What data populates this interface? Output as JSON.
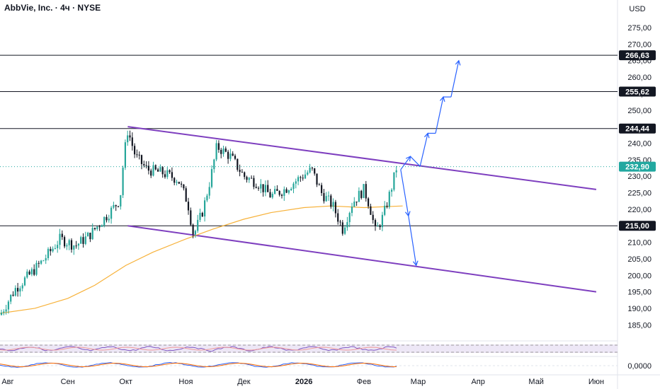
{
  "header": {
    "title": "AbbVie, Inc. · 4ч · NYSE"
  },
  "colors": {
    "up": "#26a69a",
    "down": "#131722",
    "ma": "#f7b23b",
    "channel": "#7e3fbf",
    "projection": "#2962ff",
    "price_tag": "#22a8a0",
    "level": "#131722"
  },
  "chart_data": {
    "type": "candlestick",
    "currency_label": "USD",
    "ylim": [
      181,
      278
    ],
    "y_ticks": [
      "275,00",
      "270,00",
      "265,00",
      "260,00",
      "255,00",
      "250,00",
      "245,00",
      "240,00",
      "235,00",
      "230,00",
      "225,00",
      "220,00",
      "215,00",
      "210,00",
      "205,00",
      "200,00",
      "195,00",
      "190,00",
      "185,00"
    ],
    "y_tick_values": [
      275,
      270,
      265,
      260,
      255,
      250,
      245,
      240,
      235,
      230,
      225,
      220,
      215,
      210,
      205,
      200,
      195,
      190,
      185
    ],
    "x_range": [
      "2025-07-28",
      "2026-06-12"
    ],
    "x_ticks": [
      {
        "label": "Авг",
        "date": "2025-08-01"
      },
      {
        "label": "Сен",
        "date": "2025-09-01"
      },
      {
        "label": "Окт",
        "date": "2025-10-01"
      },
      {
        "label": "Ноя",
        "date": "2025-11-01"
      },
      {
        "label": "Дек",
        "date": "2025-12-01"
      },
      {
        "label": "2026",
        "date": "2026-01-01",
        "bold": true
      },
      {
        "label": "Фев",
        "date": "2026-02-01"
      },
      {
        "label": "Мар",
        "date": "2026-03-01"
      },
      {
        "label": "Апр",
        "date": "2026-04-01"
      },
      {
        "label": "Май",
        "date": "2026-05-01"
      },
      {
        "label": "Июн",
        "date": "2026-06-01"
      }
    ],
    "price_path": [
      [
        "2025-07-28",
        188
      ],
      [
        "2025-08-05",
        196
      ],
      [
        "2025-08-12",
        200
      ],
      [
        "2025-08-20",
        205
      ],
      [
        "2025-08-28",
        211
      ],
      [
        "2025-09-05",
        209
      ],
      [
        "2025-09-12",
        212
      ],
      [
        "2025-09-18",
        216
      ],
      [
        "2025-09-24",
        220
      ],
      [
        "2025-09-28",
        223
      ],
      [
        "2025-09-30",
        236
      ],
      [
        "2025-10-02",
        244
      ],
      [
        "2025-10-06",
        236
      ],
      [
        "2025-10-12",
        232
      ],
      [
        "2025-10-20",
        231
      ],
      [
        "2025-10-28",
        229
      ],
      [
        "2025-11-02",
        222
      ],
      [
        "2025-11-05",
        212
      ],
      [
        "2025-11-10",
        220
      ],
      [
        "2025-11-14",
        230
      ],
      [
        "2025-11-17",
        239
      ],
      [
        "2025-11-24",
        236
      ],
      [
        "2025-12-01",
        230
      ],
      [
        "2025-12-08",
        228
      ],
      [
        "2025-12-15",
        224
      ],
      [
        "2025-12-22",
        226
      ],
      [
        "2025-12-31",
        230
      ],
      [
        "2026-01-05",
        232
      ],
      [
        "2026-01-10",
        225
      ],
      [
        "2026-01-16",
        221
      ],
      [
        "2026-01-21",
        214
      ],
      [
        "2026-01-26",
        222
      ],
      [
        "2026-02-01",
        226
      ],
      [
        "2026-02-04",
        221
      ],
      [
        "2026-02-07",
        213
      ],
      [
        "2026-02-11",
        218
      ],
      [
        "2026-02-15",
        226
      ],
      [
        "2026-02-18",
        233
      ]
    ],
    "moving_average": [
      [
        "2025-07-28",
        188.5
      ],
      [
        "2025-08-15",
        190
      ],
      [
        "2025-09-01",
        193
      ],
      [
        "2025-09-15",
        197
      ],
      [
        "2025-10-01",
        203
      ],
      [
        "2025-10-15",
        207
      ],
      [
        "2025-11-01",
        211
      ],
      [
        "2025-11-15",
        214
      ],
      [
        "2025-12-01",
        217
      ],
      [
        "2025-12-15",
        219
      ],
      [
        "2026-01-01",
        220.5
      ],
      [
        "2026-01-15",
        221
      ],
      [
        "2026-02-01",
        220.5
      ],
      [
        "2026-02-21",
        221
      ]
    ],
    "horizontal_levels": [
      266.63,
      255.62,
      244.44,
      215.0
    ],
    "level_labels": [
      "266,63",
      "255,62",
      "244,44",
      "215,00"
    ],
    "last_price": 232.9,
    "last_price_label": "232,90",
    "channel_lines": [
      {
        "start": [
          "2025-10-02",
          245
        ],
        "end": [
          "2026-06-01",
          226
        ]
      },
      {
        "start": [
          "2025-10-02",
          215
        ],
        "end": [
          "2026-06-01",
          195
        ]
      }
    ],
    "projection_paths": [
      [
        [
          "2026-02-20",
          232
        ],
        [
          "2026-02-25",
          236
        ],
        [
          "2026-03-02",
          233
        ],
        [
          "2026-03-06",
          243
        ],
        [
          "2026-03-10",
          243
        ],
        [
          "2026-03-14",
          254
        ],
        [
          "2026-03-18",
          254
        ],
        [
          "2026-03-22",
          265
        ]
      ],
      [
        [
          "2026-02-20",
          232
        ],
        [
          "2026-02-24",
          218
        ],
        [
          "2026-02-28",
          203
        ]
      ]
    ],
    "indicator_zero_label": "0,0000"
  }
}
